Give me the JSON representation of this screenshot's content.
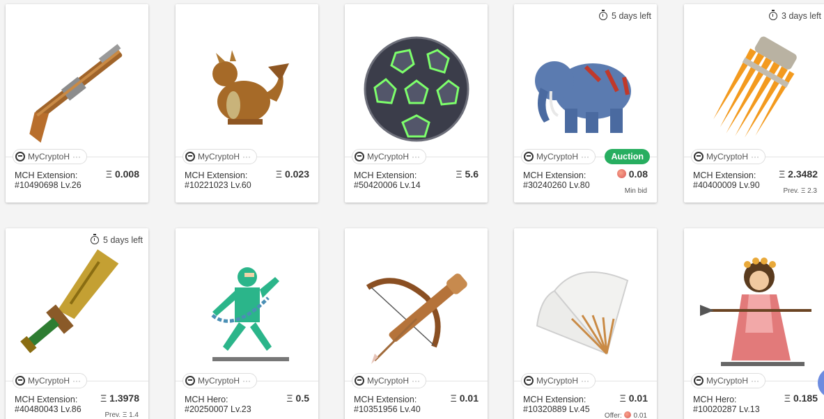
{
  "cards": [
    {
      "owner": "MyCryptoH",
      "type": "MCH Extension:",
      "id_level": "#10490698 Lv.26",
      "currency": "Ξ",
      "price": "0.008"
    },
    {
      "owner": "MyCryptoH",
      "type": "MCH Extension:",
      "id_level": "#10221023 Lv.60",
      "currency": "Ξ",
      "price": "0.023"
    },
    {
      "owner": "MyCryptoH",
      "type": "MCH Extension:",
      "id_level": "#50420006 Lv.14",
      "currency": "Ξ",
      "price": "5.6"
    },
    {
      "timer": "5 days left",
      "owner": "MyCryptoH",
      "badge": "Auction",
      "type": "MCH Extension:",
      "id_level": "#30240260 Lv.80",
      "price": "0.08",
      "sub": "Min bid"
    },
    {
      "timer": "3 days left",
      "owner": "MyCryptoH",
      "type": "MCH Extension:",
      "id_level": "#40400009 Lv.90",
      "currency": "Ξ",
      "price": "2.3482",
      "sub": "Prev. Ξ 2.3"
    },
    {
      "timer": "5 days left",
      "owner": "MyCryptoH",
      "type": "MCH Extension:",
      "id_level": "#40480043 Lv.86",
      "currency": "Ξ",
      "price": "1.3978",
      "sub": "Prev. Ξ 1.4"
    },
    {
      "owner": "MyCryptoH",
      "type": "MCH Hero:",
      "id_level": "#20250007 Lv.23",
      "currency": "Ξ",
      "price": "0.5"
    },
    {
      "owner": "MyCryptoH",
      "type": "MCH Extension:",
      "id_level": "#10351956 Lv.40",
      "currency": "Ξ",
      "price": "0.01"
    },
    {
      "owner": "MyCryptoH",
      "type": "MCH Extension:",
      "id_level": "#10320889 Lv.45",
      "currency": "Ξ",
      "price": "0.01",
      "offer_label": "Offer:",
      "offer_value": "0.01"
    },
    {
      "owner": "MyCryptoH",
      "type": "MCH Hero:",
      "id_level": "#10020287 Lv.13",
      "currency": "Ξ",
      "price": "0.185"
    }
  ],
  "owner_more": "···",
  "icons": {
    "timer": "stopwatch-icon",
    "owner": "mch-owner-icon",
    "wc_coin": "wc-coin-icon"
  },
  "colors": {
    "auction_badge": "#27ae60",
    "card_bg": "#ffffff",
    "page_bg": "#f4f4f4"
  }
}
